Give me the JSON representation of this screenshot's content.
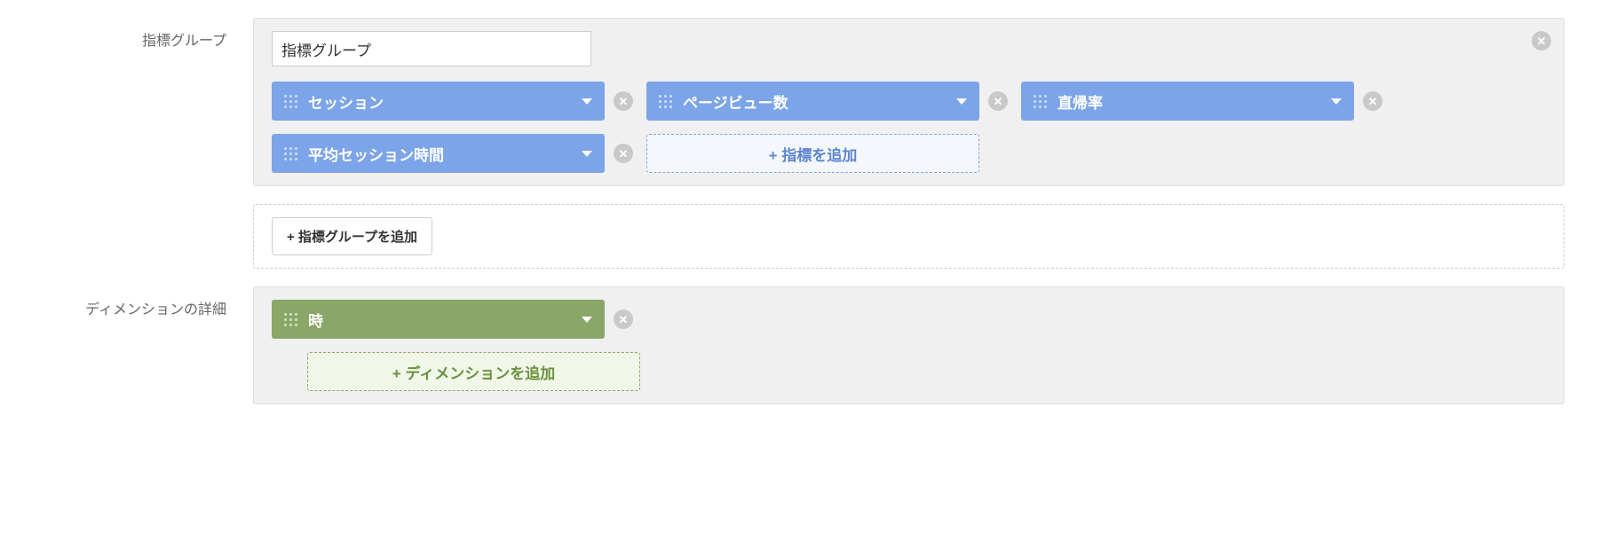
{
  "colors": {
    "blue": "#7ca4e8",
    "green": "#89a767",
    "panel_bg": "#f0f0f0"
  },
  "metric_group": {
    "section_label": "指標グループ",
    "name_value": "指標グループ",
    "metrics": [
      {
        "label": "セッション"
      },
      {
        "label": "ページビュー数"
      },
      {
        "label": "直帰率"
      },
      {
        "label": "平均セッション時間"
      }
    ],
    "add_metric_label": "+ 指標を追加",
    "add_group_label": "+ 指標グループを追加"
  },
  "dimension": {
    "section_label": "ディメンションの詳細",
    "items": [
      {
        "label": "時"
      }
    ],
    "add_dimension_label": "+ ディメンションを追加"
  }
}
